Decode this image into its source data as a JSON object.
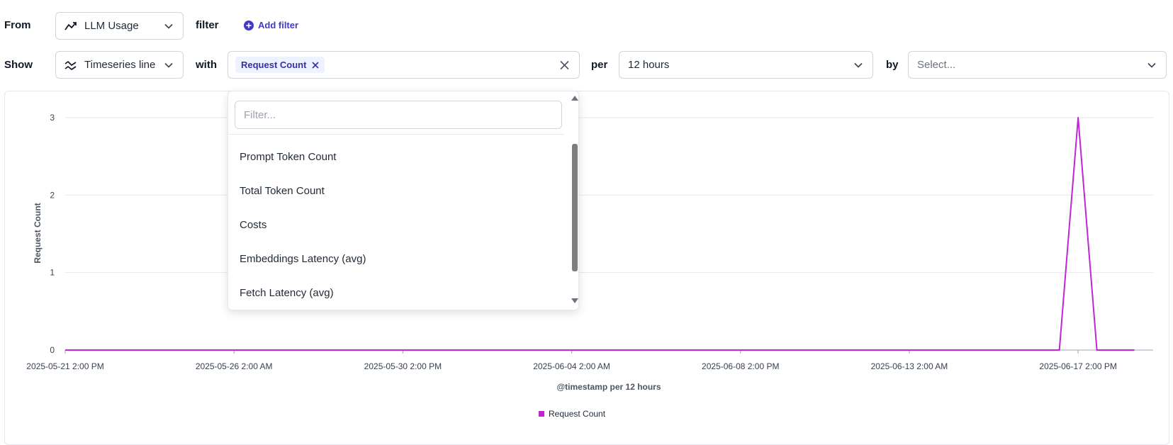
{
  "row1": {
    "from_label": "From",
    "source_value": "LLM Usage",
    "filter_label": "filter",
    "add_filter_label": "Add filter"
  },
  "row2": {
    "show_label": "Show",
    "viz_value": "Timeseries line",
    "with_label": "with",
    "metric_chip": "Request Count",
    "per_label": "per",
    "interval_value": "12 hours",
    "by_label": "by",
    "by_placeholder": "Select..."
  },
  "dropdown": {
    "filter_placeholder": "Filter...",
    "options": [
      "Prompt Token Count",
      "Total Token Count",
      "Costs",
      "Embeddings Latency (avg)",
      "Fetch Latency (avg)"
    ]
  },
  "colors": {
    "accent": "#4338ca",
    "series": "#c026d3",
    "chip_bg": "#eef2ff"
  },
  "chart_data": {
    "type": "line",
    "xlabel": "@timestamp per 12 hours",
    "ylabel": "Request Count",
    "ylim": [
      0,
      3
    ],
    "yticks": [
      0,
      1,
      2,
      3
    ],
    "xticks": [
      "2025-05-21 2:00 PM",
      "2025-05-26 2:00 AM",
      "2025-05-30 2:00 PM",
      "2025-06-04 2:00 AM",
      "2025-06-08 2:00 PM",
      "2025-06-13 2:00 AM",
      "2025-06-17 2:00 PM"
    ],
    "x_start": "2025-05-21 2:00 PM",
    "x_end": "2025-06-19 2:00 AM",
    "x_step_hours": 12,
    "series": [
      {
        "name": "Request Count",
        "color": "#c026d3",
        "points": [
          {
            "x": "2025-05-21 2:00 PM",
            "y": 0
          },
          {
            "x": "2025-06-17 2:00 AM",
            "y": 0
          },
          {
            "x": "2025-06-17 2:00 PM",
            "y": 3
          },
          {
            "x": "2025-06-18 2:00 AM",
            "y": 0
          },
          {
            "x": "2025-06-19 2:00 AM",
            "y": 0
          }
        ]
      }
    ],
    "legend": [
      "Request Count"
    ],
    "legend_position": "bottom",
    "grid": true
  }
}
